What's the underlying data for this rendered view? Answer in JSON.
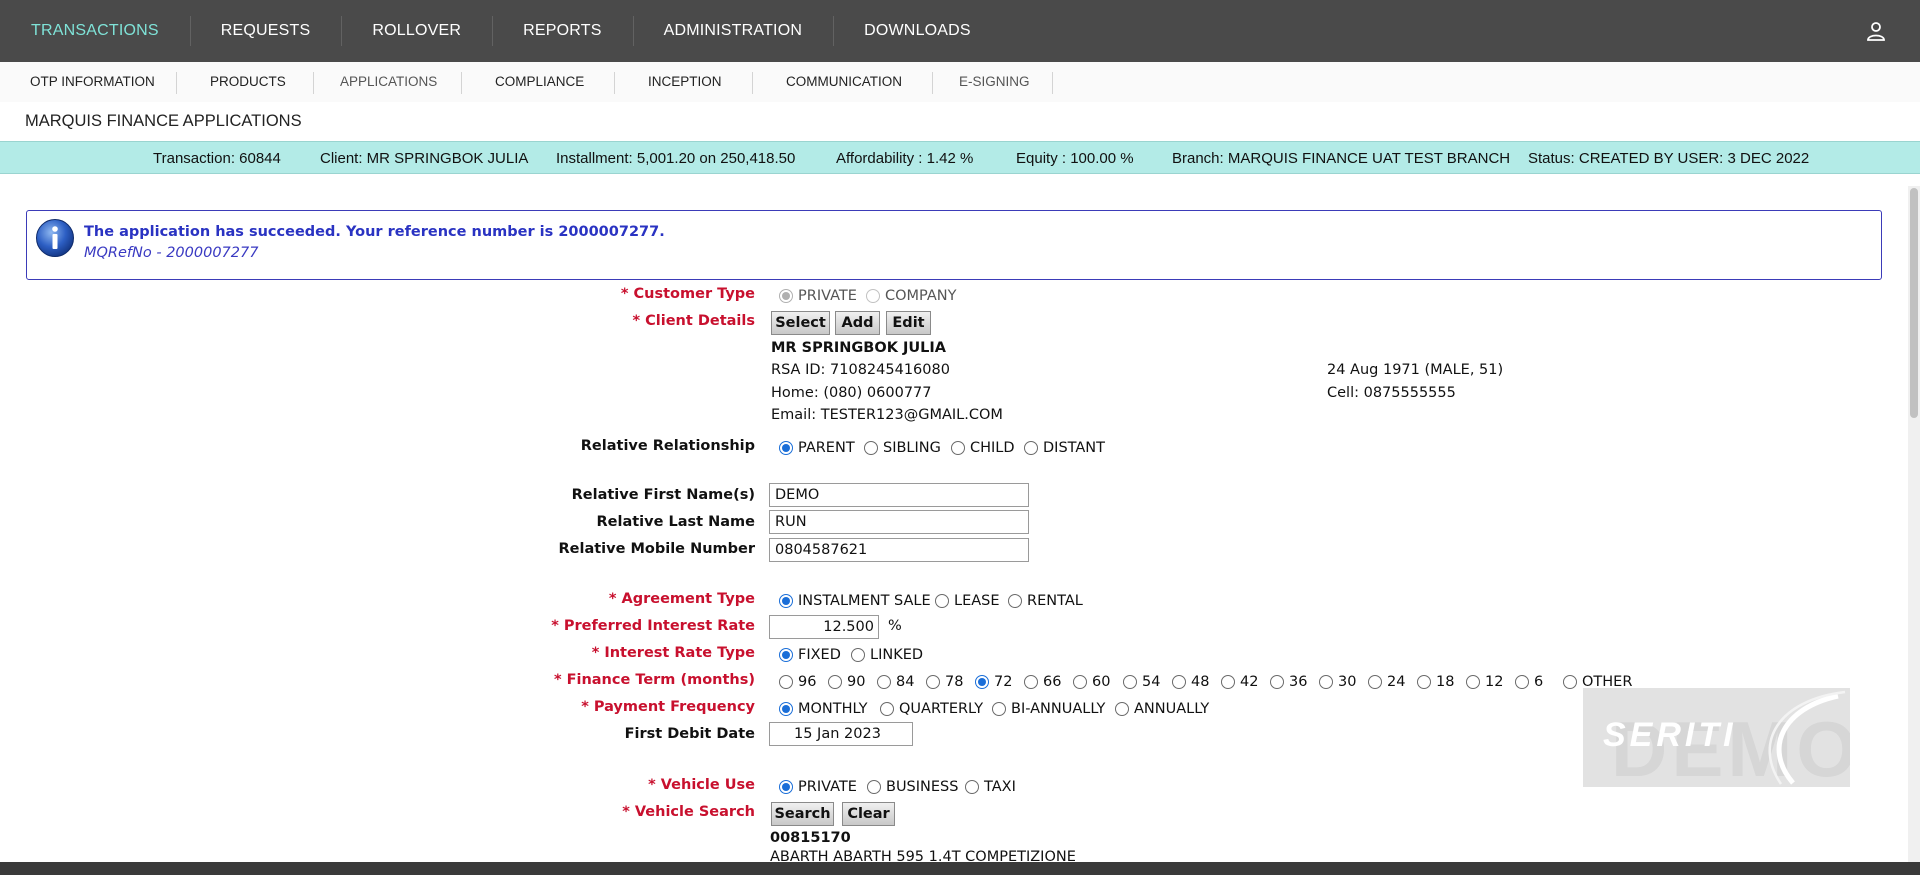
{
  "topnav": {
    "items": [
      "TRANSACTIONS",
      "REQUESTS",
      "ROLLOVER",
      "REPORTS",
      "ADMINISTRATION",
      "DOWNLOADS"
    ],
    "active": "TRANSACTIONS",
    "accent": "#7fe3d8",
    "user_icon": "user-icon"
  },
  "subnav": {
    "items": [
      "OTP INFORMATION",
      "PRODUCTS",
      "APPLICATIONS",
      "COMPLIANCE",
      "INCEPTION",
      "COMMUNICATION",
      "E-SIGNING"
    ]
  },
  "page_title": "MARQUIS FINANCE APPLICATIONS",
  "status": {
    "transaction": "Transaction: 60844",
    "client": "Client: MR SPRINGBOK JULIA",
    "installment": "Installment: 5,001.20 on 250,418.50",
    "affordability": "Affordability : 1.42 %",
    "equity": "Equity : 100.00 %",
    "branch": "Branch: MARQUIS FINANCE UAT TEST BRANCH",
    "state": "Status: CREATED BY USER: 3 DEC 2022",
    "bg_color": "#b3ebe7"
  },
  "info": {
    "icon": "info-icon",
    "message": "The application has succeeded. Your reference number is 2000007277.",
    "ref": "MQRefNo - 2000007277"
  },
  "form": {
    "customer_type": {
      "label": "* Customer Type",
      "options": [
        "PRIVATE",
        "COMPANY"
      ],
      "selected": "PRIVATE"
    },
    "client_details": {
      "label": "* Client Details",
      "buttons": [
        "Select",
        "Add",
        "Edit"
      ],
      "name": "MR SPRINGBOK JULIA",
      "rsa_id": "RSA ID: 7108245416080",
      "home": "Home: (080) 0600777",
      "email": "Email: TESTER123@GMAIL.COM",
      "dob": "24 Aug 1971 (MALE, 51)",
      "cell": "Cell: 0875555555"
    },
    "relative_relationship": {
      "label": "Relative Relationship",
      "options": [
        "PARENT",
        "SIBLING",
        "CHILD",
        "DISTANT"
      ],
      "selected": "PARENT"
    },
    "relative_first_name": {
      "label": "Relative First Name(s)",
      "value": "DEMO"
    },
    "relative_last_name": {
      "label": "Relative Last Name",
      "value": "RUN"
    },
    "relative_mobile": {
      "label": "Relative Mobile Number",
      "value": "0804587621"
    },
    "agreement_type": {
      "label": "* Agreement Type",
      "options": [
        "INSTALMENT SALE",
        "LEASE",
        "RENTAL"
      ],
      "selected": "INSTALMENT SALE"
    },
    "interest_rate": {
      "label": "* Preferred Interest Rate",
      "value": "12.500",
      "unit": "%"
    },
    "interest_rate_type": {
      "label": "* Interest Rate Type",
      "options": [
        "FIXED",
        "LINKED"
      ],
      "selected": "FIXED"
    },
    "finance_term": {
      "label": "* Finance Term (months)",
      "options": [
        "96",
        "90",
        "84",
        "78",
        "72",
        "66",
        "60",
        "54",
        "48",
        "42",
        "36",
        "30",
        "24",
        "18",
        "12",
        "6",
        "OTHER"
      ],
      "selected": "72"
    },
    "payment_frequency": {
      "label": "* Payment Frequency",
      "options": [
        "MONTHLY",
        "QUARTERLY",
        "BI-ANNUALLY",
        "ANNUALLY"
      ],
      "selected": "MONTHLY"
    },
    "first_debit_date": {
      "label": "First Debit Date",
      "value": "15 Jan 2023"
    },
    "vehicle_use": {
      "label": "* Vehicle Use",
      "options": [
        "PRIVATE",
        "BUSINESS",
        "TAXI"
      ],
      "selected": "PRIVATE"
    },
    "vehicle_search": {
      "label": "* Vehicle Search",
      "buttons": [
        "Search",
        "Clear"
      ],
      "code": "00815170",
      "description": "ABARTH ABARTH 595 1.4T COMPETIZIONE"
    }
  },
  "watermark": {
    "text": "SERITI",
    "bg_text": "DEMO"
  }
}
